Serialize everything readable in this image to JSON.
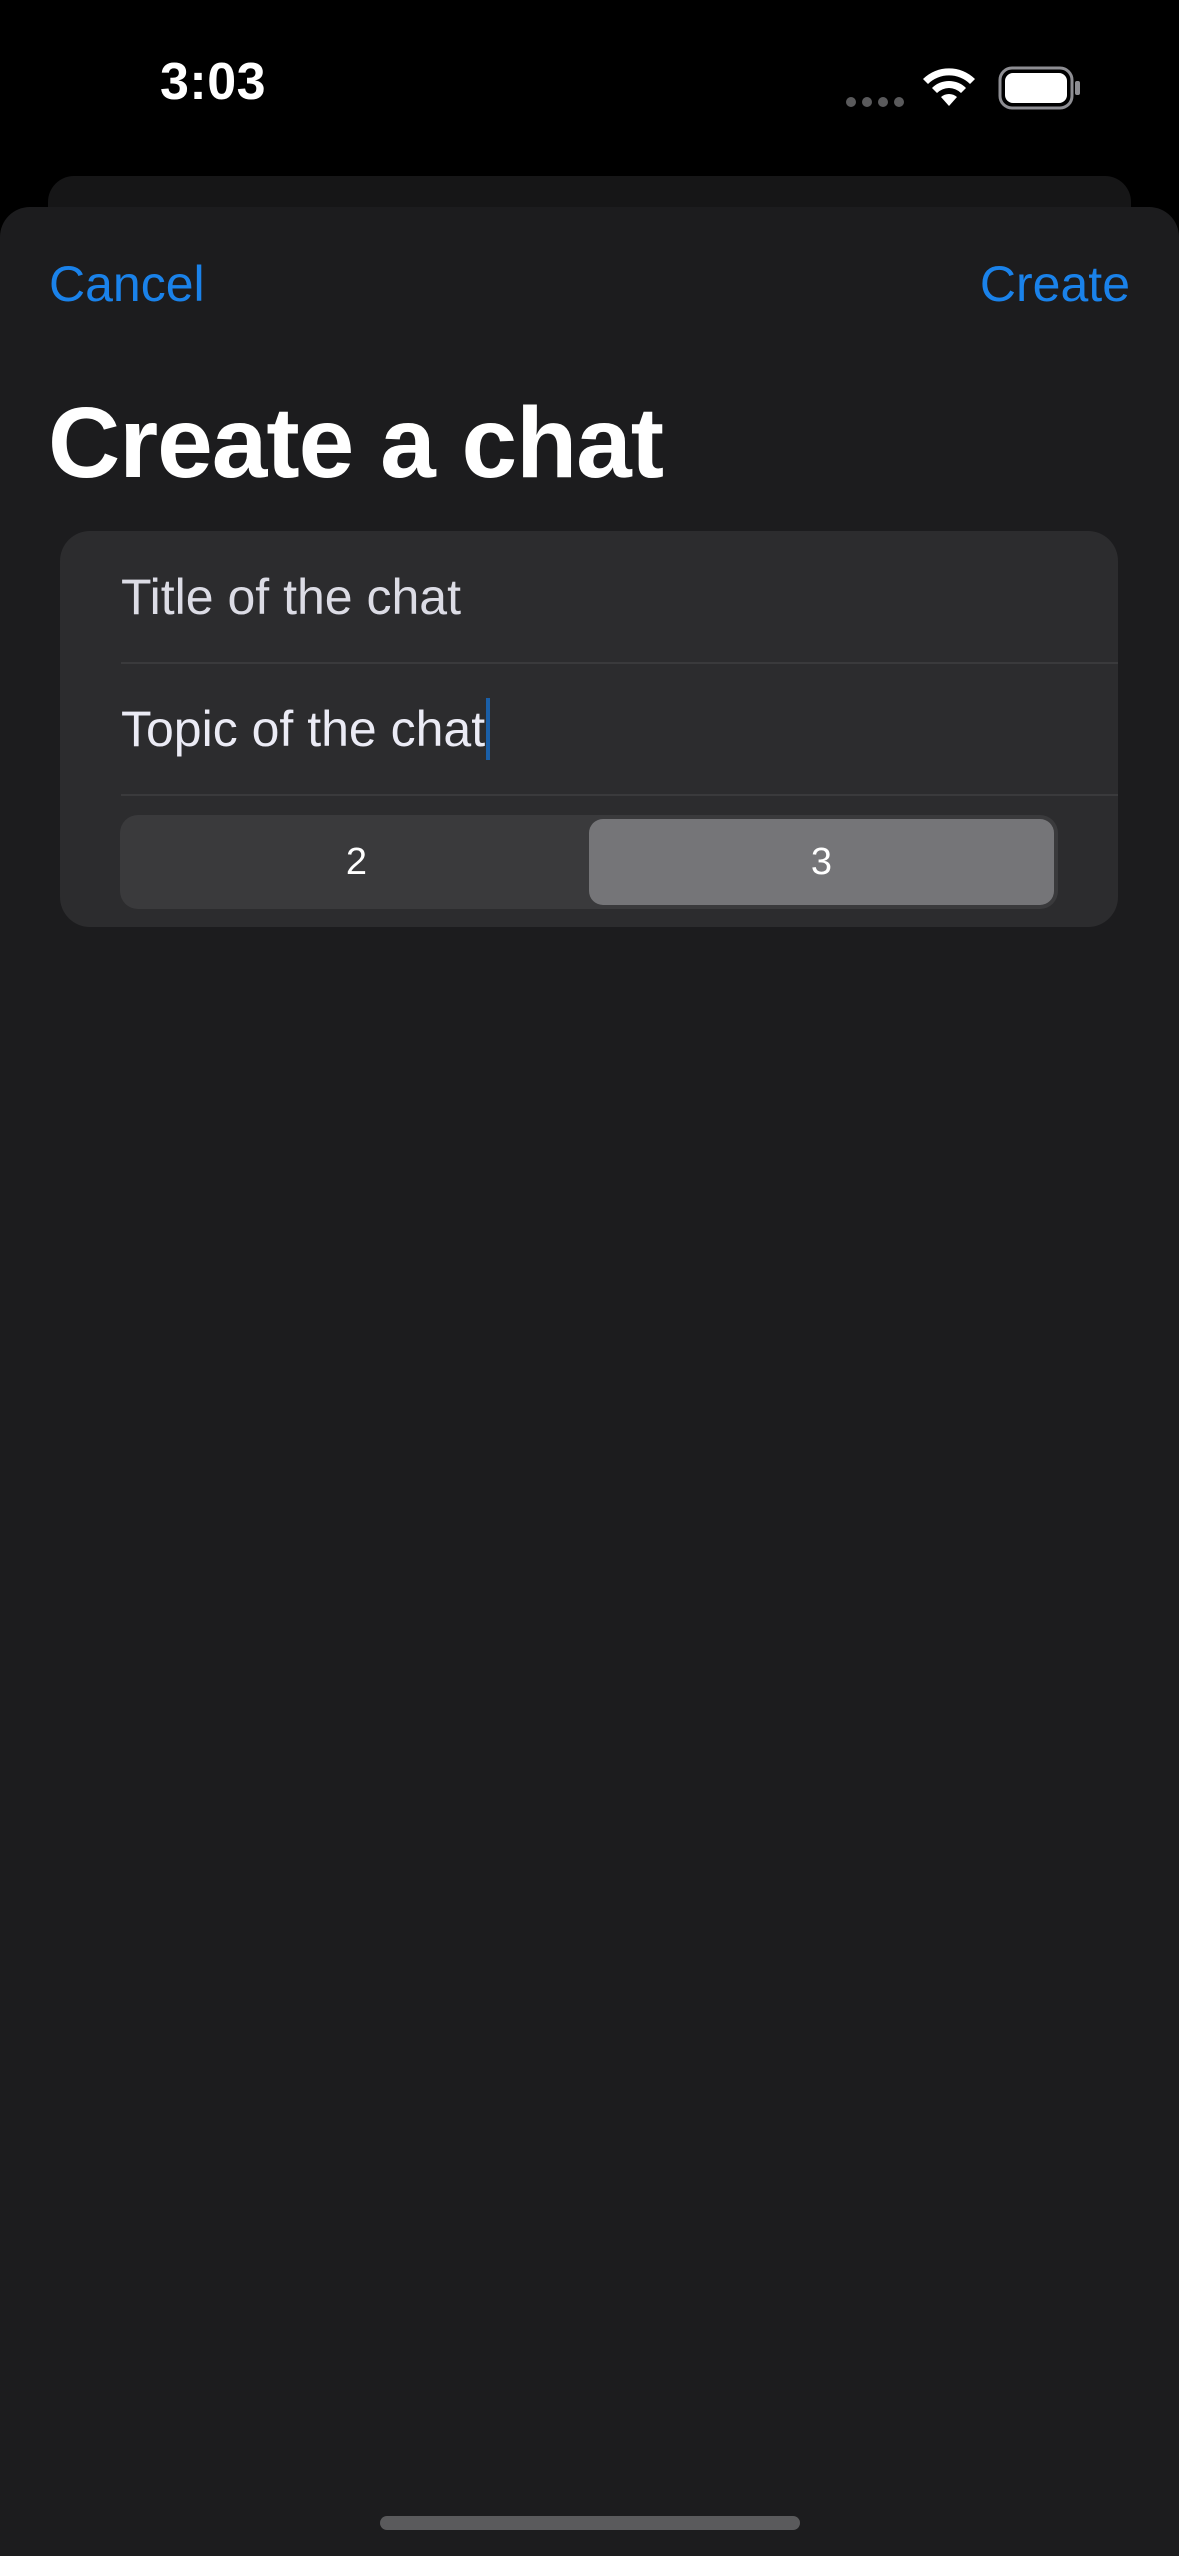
{
  "status_bar": {
    "time": "3:03",
    "icons": [
      "cellular-signal-icon",
      "wifi-icon",
      "battery-icon"
    ]
  },
  "nav": {
    "cancel_label": "Cancel",
    "create_label": "Create"
  },
  "page": {
    "title": "Create a chat"
  },
  "form": {
    "title_field": {
      "value": "",
      "placeholder": "Title of the chat"
    },
    "topic_field": {
      "value": "",
      "placeholder": "Topic of the chat",
      "focused": true
    },
    "segmented": {
      "options": [
        "2",
        "3"
      ],
      "selected": "3"
    }
  },
  "colors": {
    "accent": "#1a82ea",
    "background": "#1c1c1e",
    "group_background": "#2c2c2e",
    "segment_selected": "#757578"
  }
}
